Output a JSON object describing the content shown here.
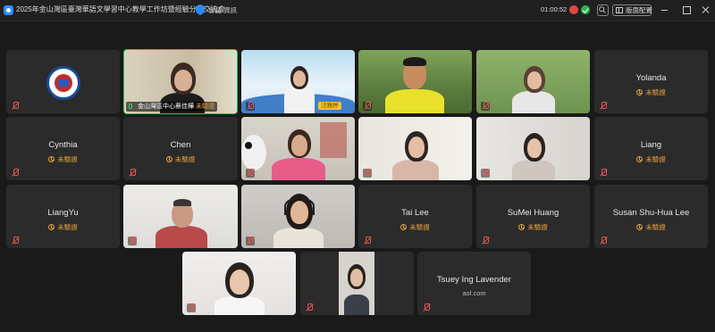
{
  "window": {
    "title": "2025年金山灣區臺灣華語文學習中心教學工作坊暨經驗分享交流會",
    "meeting_info": "會議 資訊",
    "timer": "01:00:52",
    "layout_button": "版面配置"
  },
  "status_text": "未驗證",
  "participants": [
    {
      "name": "",
      "kind": "logo"
    },
    {
      "name": "金山灣區中心蔡佳樺",
      "kind": "video",
      "tag_status": "未驗證"
    },
    {
      "name": "汪雅婷",
      "kind": "video"
    },
    {
      "name": "",
      "kind": "video"
    },
    {
      "name": "",
      "kind": "video"
    },
    {
      "name": "Yolanda",
      "kind": "audio"
    },
    {
      "name": "Cynthia",
      "kind": "audio"
    },
    {
      "name": "Chen",
      "kind": "audio"
    },
    {
      "name": "",
      "kind": "video"
    },
    {
      "name": "",
      "kind": "video"
    },
    {
      "name": "",
      "kind": "video"
    },
    {
      "name": "Liang",
      "kind": "audio"
    },
    {
      "name": "LiangYu",
      "kind": "audio"
    },
    {
      "name": "",
      "kind": "video"
    },
    {
      "name": "",
      "kind": "video"
    },
    {
      "name": "Tai Lee",
      "kind": "audio"
    },
    {
      "name": "SuMei Huang",
      "kind": "audio"
    },
    {
      "name": "Susan Shu-Hua Lee",
      "kind": "audio"
    },
    {
      "name": "",
      "kind": "video"
    },
    {
      "name": "",
      "kind": "video"
    },
    {
      "name": "Tsuey Ing Lavender",
      "kind": "audio",
      "subtitle": "aol.com"
    }
  ],
  "colors": {
    "background": "#1a1a1a",
    "tile": "#2b2b2b",
    "active_border": "#2ec15a",
    "unverified": "#e6a23c"
  }
}
